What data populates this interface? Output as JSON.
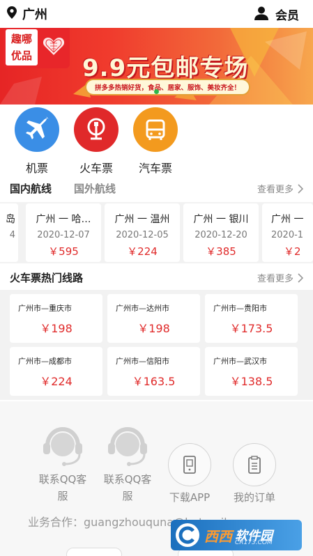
{
  "header": {
    "city": "广州",
    "member_label": "会员"
  },
  "banner": {
    "logo_line1": "趣哪",
    "logo_line2": "优品",
    "title": "9.9元包邮专场",
    "subtitle": "拼多多热销好货，食品、居家、服饰、美妆齐全！",
    "accent_color": "#e62525"
  },
  "categories": [
    {
      "label": "机票",
      "icon": "airplane-icon",
      "color": "#3a8ee6"
    },
    {
      "label": "火车票",
      "icon": "train-icon",
      "color": "#e0292a"
    },
    {
      "label": "汽车票",
      "icon": "bus-icon",
      "color": "#f39a1e"
    }
  ],
  "flights_section": {
    "tab_domestic": "国内航线",
    "tab_international": "国外航线",
    "more": "查看更多",
    "partial_left_top": "岛",
    "partial_left_bottom": "4",
    "cards": [
      {
        "route": "广州 一 哈…",
        "date": "2020-12-07",
        "price": "￥595"
      },
      {
        "route": "广州 一 温州",
        "date": "2020-12-05",
        "price": "￥224"
      },
      {
        "route": "广州 一 银川",
        "date": "2020-12-20",
        "price": "￥385"
      },
      {
        "route": "广州 一",
        "date": "2020-1",
        "price": "￥2"
      }
    ]
  },
  "trains_section": {
    "title": "火车票热门线路",
    "more": "查看更多",
    "routes": [
      {
        "route": "广州市—重庆市",
        "price": "￥198"
      },
      {
        "route": "广州市—达州市",
        "price": "￥198"
      },
      {
        "route": "广州市—贵阳市",
        "price": "￥173.5"
      },
      {
        "route": "广州市—成都市",
        "price": "￥224"
      },
      {
        "route": "广州市—信阳市",
        "price": "￥163.5"
      },
      {
        "route": "广州市—武汉市",
        "price": "￥138.5"
      }
    ]
  },
  "footer": {
    "qq1_line1": "联系QQ客",
    "qq1_line2": "服",
    "qq2_line1": "联系QQ客",
    "qq2_line2": "服",
    "download": "下载APP",
    "orders": "我的订单",
    "business": "业务合作：guangzhouquna@hotmail.com"
  },
  "watermark": {
    "t1": "西西",
    "t2": "软件园",
    "t3": "CR173.COM"
  }
}
